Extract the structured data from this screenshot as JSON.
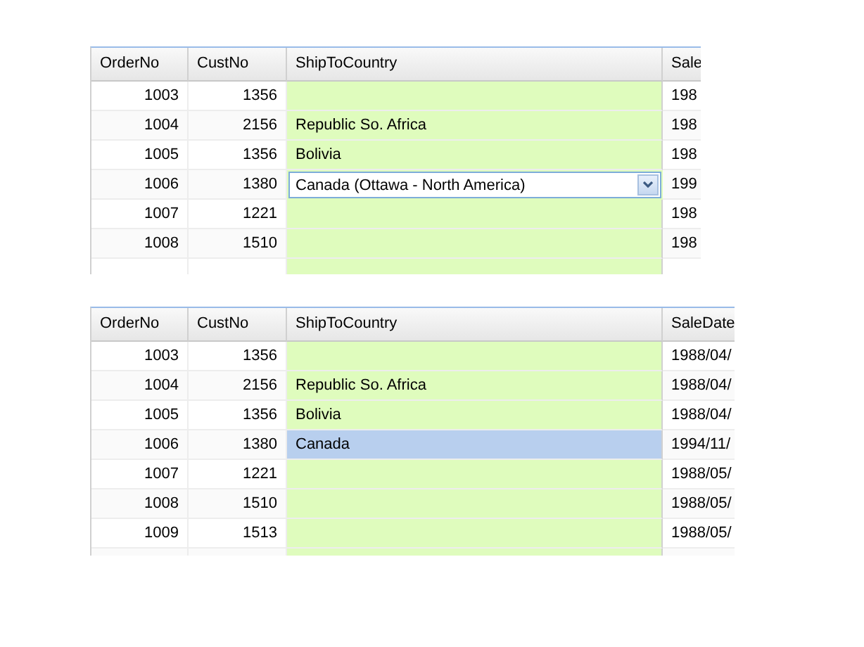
{
  "grids": [
    {
      "columns": [
        "OrderNo",
        "CustNo",
        "ShipToCountry",
        "Sale"
      ],
      "rows": [
        {
          "cells": [
            "1003",
            "1356",
            "",
            "198"
          ],
          "selected": false,
          "editing": false
        },
        {
          "cells": [
            "1004",
            "2156",
            "Republic So. Africa",
            "198"
          ],
          "selected": false,
          "editing": false
        },
        {
          "cells": [
            "1005",
            "1356",
            "Bolivia",
            "198"
          ],
          "selected": false,
          "editing": false
        },
        {
          "cells": [
            "1006",
            "1380",
            "",
            "199"
          ],
          "selected": false,
          "editing": true,
          "editor_value": "Canada (Ottawa - North America)"
        },
        {
          "cells": [
            "1007",
            "1221",
            "",
            "198"
          ],
          "selected": false,
          "editing": false
        },
        {
          "cells": [
            "1008",
            "1510",
            "",
            "198"
          ],
          "selected": false,
          "editing": false
        }
      ]
    },
    {
      "columns": [
        "OrderNo",
        "CustNo",
        "ShipToCountry",
        "SaleDate"
      ],
      "rows": [
        {
          "cells": [
            "1003",
            "1356",
            "",
            "1988/04/"
          ],
          "selected": false,
          "editing": false
        },
        {
          "cells": [
            "1004",
            "2156",
            "Republic So. Africa",
            "1988/04/"
          ],
          "selected": false,
          "editing": false
        },
        {
          "cells": [
            "1005",
            "1356",
            "Bolivia",
            "1988/04/"
          ],
          "selected": false,
          "editing": false
        },
        {
          "cells": [
            "1006",
            "1380",
            "Canada",
            "1994/11/"
          ],
          "selected": true,
          "editing": false
        },
        {
          "cells": [
            "1007",
            "1221",
            "",
            "1988/05/"
          ],
          "selected": false,
          "editing": false
        },
        {
          "cells": [
            "1008",
            "1510",
            "",
            "1988/05/"
          ],
          "selected": false,
          "editing": false
        },
        {
          "cells": [
            "1009",
            "1513",
            "",
            "1988/05/"
          ],
          "selected": false,
          "editing": false
        }
      ]
    }
  ]
}
